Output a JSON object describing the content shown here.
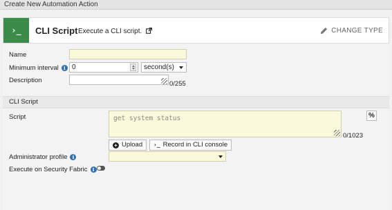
{
  "dialog": {
    "title": "Create New Automation Action"
  },
  "header": {
    "icon_glyph": "›_",
    "title": "CLI Script",
    "subtitle": "Execute a CLI script.",
    "change_type_label": "CHANGE TYPE"
  },
  "form": {
    "name": {
      "label": "Name",
      "value": ""
    },
    "minimum_interval": {
      "label": "Minimum interval",
      "value": "0",
      "unit": "second(s)"
    },
    "description": {
      "label": "Description",
      "value": "",
      "counter": "0/255"
    },
    "section_title": "CLI Script",
    "script": {
      "label": "Script",
      "placeholder": "get system status",
      "counter": "0/1023",
      "special_button": "%"
    },
    "upload_button": "Upload",
    "record_button_icon": "›_",
    "record_button": "Record in CLI console",
    "admin_profile": {
      "label": "Administrator profile",
      "value": ""
    },
    "security_fabric": {
      "label": "Execute on Security Fabric",
      "enabled": false
    }
  },
  "colors": {
    "accent": "#3d8b48",
    "info": "#2f6fb3",
    "input_bg": "#fbf9dc"
  }
}
